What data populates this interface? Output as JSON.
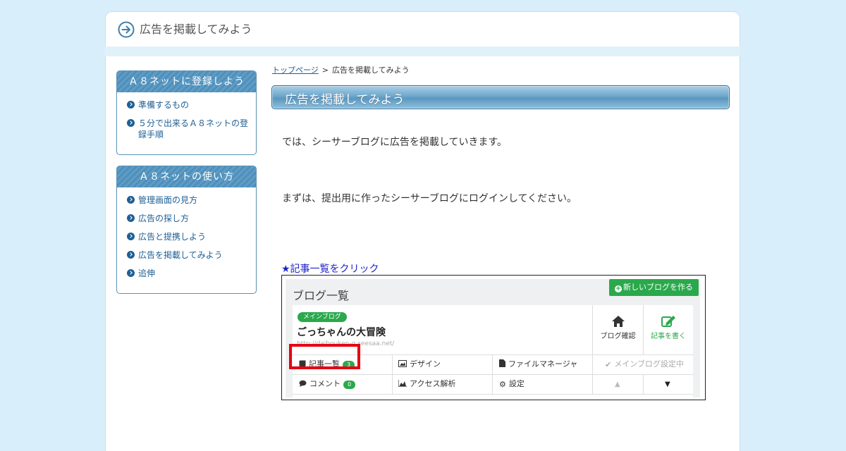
{
  "header": {
    "title": "広告を掲載してみよう"
  },
  "sidebar": {
    "sections": [
      {
        "heading": "Ａ８ネットに登録しよう",
        "items": [
          "準備するもの",
          "５分で出来るＡ８ネットの登録手順"
        ]
      },
      {
        "heading": "Ａ８ネットの使い方",
        "items": [
          "管理画面の見方",
          "広告の探し方",
          "広告と提携しよう",
          "広告を掲載してみよう",
          "追伸"
        ]
      }
    ]
  },
  "breadcrumb": {
    "home": "トップページ",
    "separator": ">",
    "current": "広告を掲載してみよう"
  },
  "main": {
    "title": "広告を掲載してみよう",
    "paragraphs": [
      "では、シーサーブログに広告を掲載していきます。",
      "まずは、提出用に作ったシーサーブログにログインしてください。"
    ],
    "caption": "★記事一覧をクリック"
  },
  "screenshot": {
    "title": "ブログ一覧",
    "new_blog_button": "新しいブログを作る",
    "main_badge": "メインブログ",
    "blog_name": "ごっちゃんの大冒険",
    "blog_url": "http://daibouken-g.seesaa.net/",
    "blog_check": "ブログ確認",
    "write_article": "記事を書く",
    "articles_label": "記事一覧",
    "articles_count": "3",
    "design_label": "デザイン",
    "file_manager_label": "ファイルマネージャ",
    "main_blog_status": "メインブログ設定中",
    "comments_label": "コメント",
    "comments_count": "0",
    "access_label": "アクセス解析",
    "settings_label": "設定",
    "highlight_color": "#e60012",
    "accent_color": "#2aa94c"
  }
}
